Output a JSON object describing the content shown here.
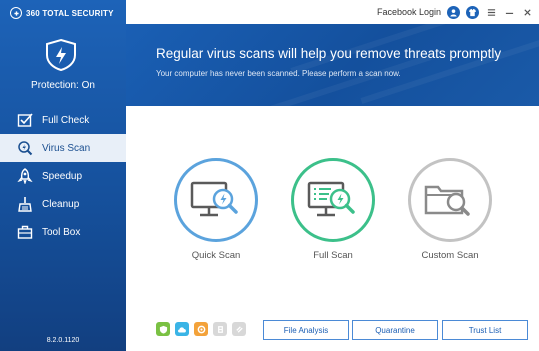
{
  "app": {
    "brand": "360 TOTAL SECURITY",
    "facebook_login": "Facebook Login",
    "protection_status": "Protection: On",
    "version": "8.2.0.1120"
  },
  "sidebar": {
    "items": [
      {
        "label": "Full Check",
        "icon": "checkbox-icon"
      },
      {
        "label": "Virus Scan",
        "icon": "virus-scan-icon",
        "active": true
      },
      {
        "label": "Speedup",
        "icon": "rocket-icon"
      },
      {
        "label": "Cleanup",
        "icon": "broom-icon"
      },
      {
        "label": "Tool Box",
        "icon": "toolbox-icon"
      }
    ]
  },
  "banner": {
    "title": "Regular virus scans will help you remove threats promptly",
    "subtitle": "Your computer has never been scanned. Please perform a scan now."
  },
  "scans": [
    {
      "label": "Quick Scan",
      "color": "#5ba3dd"
    },
    {
      "label": "Full Scan",
      "color": "#3cc08a"
    },
    {
      "label": "Custom Scan",
      "color": "#c3c3c3"
    }
  ],
  "tools": [
    "shield-green-icon",
    "cloud-icon",
    "engine-icon",
    "grey-tool-icon",
    "link-icon"
  ],
  "buttons": {
    "file_analysis": "File Analysis",
    "quarantine": "Quarantine",
    "trust_list": "Trust List"
  },
  "colors": {
    "sidebar": "#1d63b8",
    "banner": "#1a5fb4",
    "accent": "#1b5eb3"
  }
}
